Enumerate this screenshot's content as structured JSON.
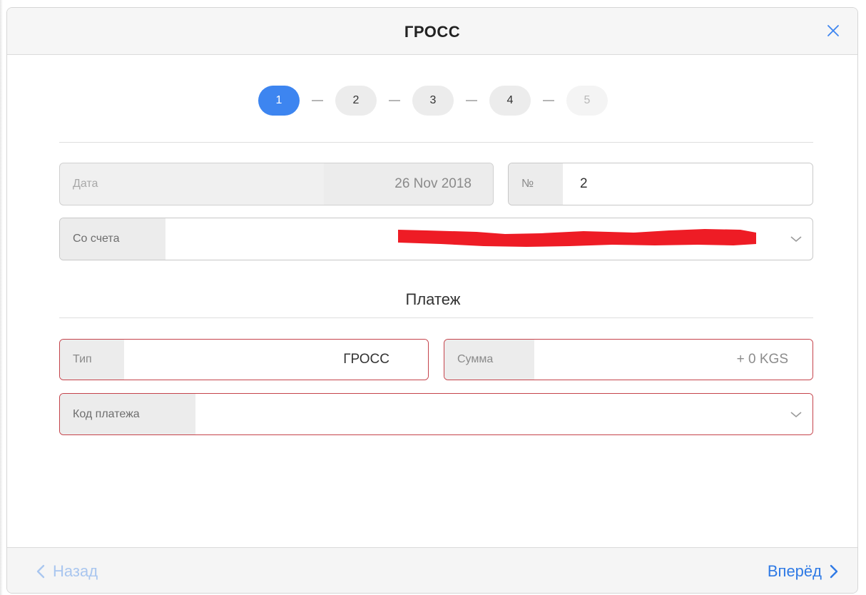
{
  "dialog": {
    "title": "ГРОСС"
  },
  "stepper": {
    "steps": [
      "1",
      "2",
      "3",
      "4",
      "5"
    ],
    "active_step": "1"
  },
  "form": {
    "date": {
      "label": "Дата",
      "value": "26 Nov 2018"
    },
    "number": {
      "label": "№",
      "value": "2"
    },
    "account": {
      "label": "Со счета",
      "value": ""
    }
  },
  "payment": {
    "section_title": "Платеж",
    "type": {
      "label": "Тип",
      "value": "ГРОСС"
    },
    "amount": {
      "label": "Сумма",
      "value": "+ 0 KGS"
    },
    "payment_code": {
      "label": "Код платежа",
      "value": ""
    }
  },
  "footer": {
    "back_label": "Назад",
    "next_label": "Вперёд"
  },
  "colors": {
    "accent": "#3d85f0",
    "error_border": "#c5434b",
    "redaction": "#ee1c25"
  },
  "icons": {
    "close": "close-icon",
    "dropdown": "chevron-down-icon",
    "back": "chevron-left-icon",
    "next": "chevron-right-icon"
  }
}
